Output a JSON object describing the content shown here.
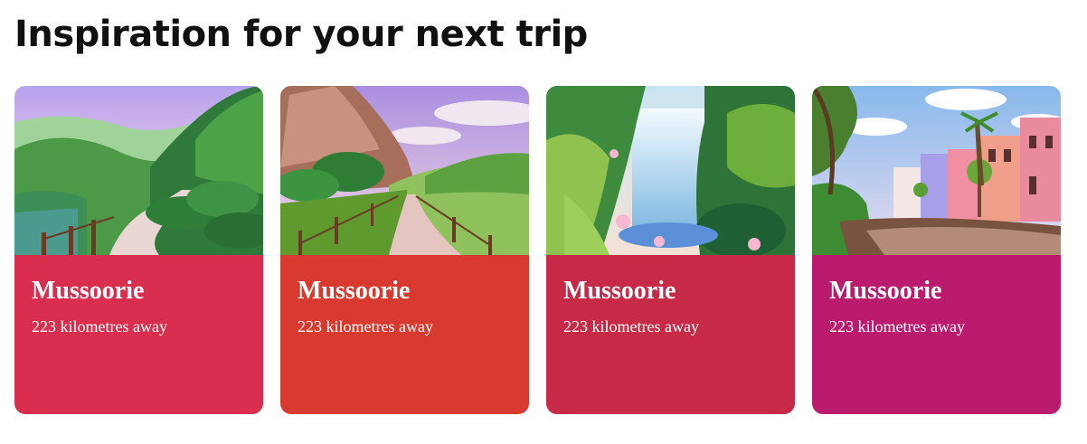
{
  "section": {
    "title": "Inspiration for your next trip"
  },
  "cards": [
    {
      "title": "Mussoorie",
      "distance": "223 kilometres away",
      "color": "#DA2E4F",
      "image": "mountain-valley-path"
    },
    {
      "title": "Mussoorie",
      "distance": "223 kilometres away",
      "color": "#D83A30",
      "image": "cliff-road-fence"
    },
    {
      "title": "Mussoorie",
      "distance": "223 kilometres away",
      "color": "#C62A47",
      "image": "jungle-waterfall"
    },
    {
      "title": "Mussoorie",
      "distance": "223 kilometres away",
      "color": "#BB1B6C",
      "image": "street-houses-palm"
    }
  ]
}
